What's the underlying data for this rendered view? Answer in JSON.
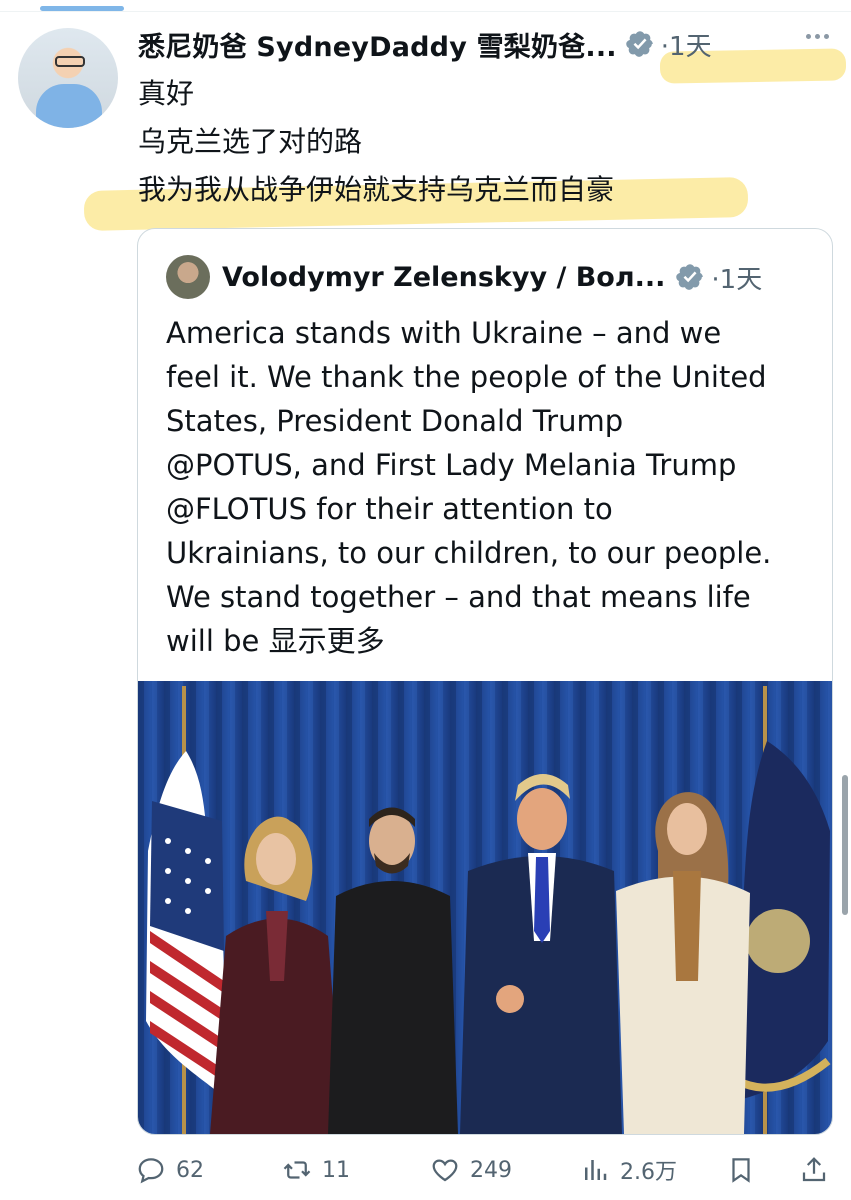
{
  "post": {
    "display_name": "悉尼奶爸 SydneyDaddy 雪梨奶爸...",
    "time": "·1天",
    "lines": [
      "真好",
      "乌克兰选了对的路",
      "我为我从战争伊始就支持乌克兰而自豪"
    ]
  },
  "quote": {
    "display_name": "Volodymyr Zelenskyy / Вол...",
    "time": "·1天",
    "lines": [
      "America stands with Ukraine – and we",
      "feel it. We thank the people of the United",
      "States, President Donald Trump",
      "@POTUS, and First Lady Melania Trump",
      "@FLOTUS for their attention to",
      "Ukrainians, to our children, to our people.",
      "We stand together – and that means life"
    ],
    "last_line_prefix": "will be ",
    "show_more": "显示更多"
  },
  "actions": {
    "replies": "62",
    "reposts": "11",
    "likes": "249",
    "views": "2.6万"
  },
  "colors": {
    "text": "#0f1419",
    "muted": "#536471",
    "verified": "#829aab",
    "highlight": "#fbe58a",
    "border": "#cfd9de"
  },
  "icons": {
    "verified": "verified-badge-icon",
    "more": "more-dots-icon",
    "reply": "reply-icon",
    "repost": "repost-icon",
    "like": "heart-icon",
    "views": "views-chart-icon",
    "bookmark": "bookmark-icon",
    "share": "share-icon"
  }
}
